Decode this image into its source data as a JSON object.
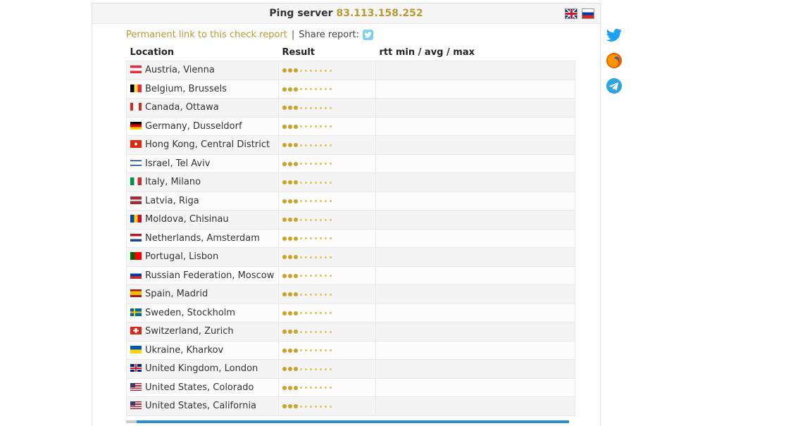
{
  "header": {
    "title": "Ping server",
    "ip": "83.113.158.252",
    "languages": [
      {
        "name": "english-flag-icon"
      },
      {
        "name": "russian-flag-icon"
      }
    ]
  },
  "report": {
    "permanent_link": "Permanent link to this check report",
    "separator": "|",
    "share_label": "Share report:"
  },
  "table": {
    "headers": [
      "Location",
      "Result",
      "rtt min / avg / max"
    ],
    "rows": [
      {
        "flag": "austria",
        "location": "Austria, Vienna"
      },
      {
        "flag": "belgium",
        "location": "Belgium, Brussels"
      },
      {
        "flag": "canada",
        "location": "Canada, Ottawa"
      },
      {
        "flag": "germany",
        "location": "Germany, Dusseldorf"
      },
      {
        "flag": "hongkong",
        "location": "Hong Kong, Central District"
      },
      {
        "flag": "israel",
        "location": "Israel, Tel Aviv"
      },
      {
        "flag": "italy",
        "location": "Italy, Milano"
      },
      {
        "flag": "latvia",
        "location": "Latvia, Riga"
      },
      {
        "flag": "moldova",
        "location": "Moldova, Chisinau"
      },
      {
        "flag": "netherlands",
        "location": "Netherlands, Amsterdam"
      },
      {
        "flag": "portugal",
        "location": "Portugal, Lisbon"
      },
      {
        "flag": "russia",
        "location": "Russian Federation, Moscow"
      },
      {
        "flag": "spain",
        "location": "Spain, Madrid"
      },
      {
        "flag": "sweden",
        "location": "Sweden, Stockholm"
      },
      {
        "flag": "switzerland",
        "location": "Switzerland, Zurich"
      },
      {
        "flag": "ukraine",
        "location": "Ukraine, Kharkov"
      },
      {
        "flag": "uk",
        "location": "United Kingdom, London"
      },
      {
        "flag": "usa",
        "location": "United States, Colorado"
      },
      {
        "flag": "usa",
        "location": "United States, California"
      }
    ]
  },
  "social": [
    "twitter-icon",
    "firefox-icon",
    "telegram-icon"
  ],
  "colors": {
    "accent": "#b99b33",
    "dot": "#c9a227",
    "twitter": "#1da1f2",
    "telegram": "#2ca5e0",
    "progress": "#2a8fd0"
  }
}
